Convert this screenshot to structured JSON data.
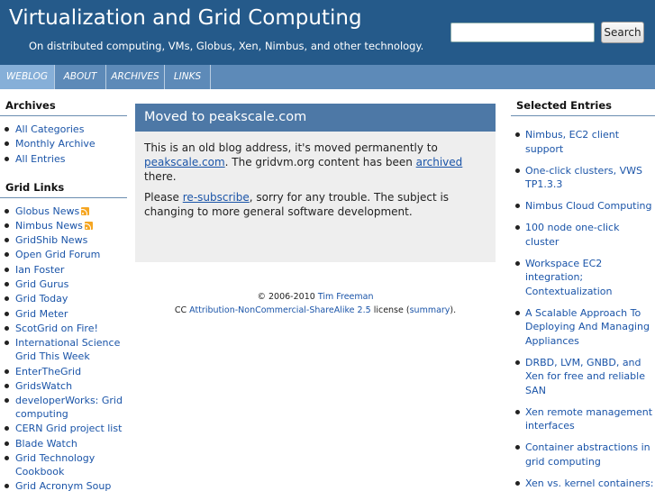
{
  "header": {
    "title": "Virtualization and Grid Computing",
    "tagline": "On distributed computing, VMs, Globus, Xen, Nimbus, and other technology.",
    "search_value": "",
    "search_button": "Search"
  },
  "nav": {
    "tabs": [
      {
        "label": "WEBLOG",
        "active": true
      },
      {
        "label": "ABOUT",
        "active": false
      },
      {
        "label": "ARCHIVES",
        "active": false
      },
      {
        "label": "LINKS",
        "active": false
      }
    ]
  },
  "left": {
    "archives_heading": "Archives",
    "archives": [
      "All Categories",
      "Monthly Archive",
      "All Entries"
    ],
    "links_heading": "Grid Links",
    "links": [
      {
        "label": "Globus News",
        "rss": true
      },
      {
        "label": "Nimbus News",
        "rss": true
      },
      {
        "label": "GridShib News",
        "rss": false
      },
      {
        "label": "Open Grid Forum",
        "rss": false
      },
      {
        "label": "Ian Foster",
        "rss": false
      },
      {
        "label": "Grid Gurus",
        "rss": false
      },
      {
        "label": "Grid Today",
        "rss": false
      },
      {
        "label": "Grid Meter",
        "rss": false
      },
      {
        "label": "ScotGrid on Fire!",
        "rss": false
      },
      {
        "label": "International Science Grid This Week",
        "rss": false
      },
      {
        "label": "EnterTheGrid",
        "rss": false
      },
      {
        "label": "GridsWatch",
        "rss": false
      },
      {
        "label": "developerWorks: Grid computing",
        "rss": false
      },
      {
        "label": "CERN Grid project list",
        "rss": false
      },
      {
        "label": "Blade Watch",
        "rss": false
      },
      {
        "label": "Grid Technology Cookbook",
        "rss": false
      },
      {
        "label": "Grid Acronym Soup",
        "rss": false
      }
    ]
  },
  "post": {
    "title": "Moved to peakscale.com",
    "p1_a": "This is an old blog address, it's moved permanently to ",
    "p1_link1": "peakscale.com",
    "p1_b": ". The gridvm.org content has been ",
    "p1_link2": "archived",
    "p1_c": " there.",
    "p2_a": "Please ",
    "p2_link": "re-subscribe",
    "p2_b": ", sorry for any trouble. The subject is changing to more general software development."
  },
  "footer": {
    "copy_a": "© 2006-2010 ",
    "author": "Tim Freeman",
    "cc_a": "CC ",
    "license": "Attribution-NonCommercial-ShareAlike 2.5",
    "cc_b": " license (",
    "summary": "summary",
    "cc_c": ")."
  },
  "right": {
    "heading": "Selected Entries",
    "entries": [
      "Nimbus, EC2 client support",
      "One-click clusters, VWS TP1.3.3",
      "Nimbus Cloud Computing",
      "100 node one-click cluster",
      "Workspace EC2 integration; Contextualization",
      "A Scalable Approach To Deploying And Managing Appliances",
      "DRBD, LVM, GNBD, and Xen for free and reliable SAN",
      "Xen remote management interfaces",
      "Container abstractions in grid computing",
      "Xen vs. kernel containers: performance and"
    ]
  },
  "colors": {
    "header_bg": "#255a8a",
    "nav_bg": "#5d8ab8",
    "nav_active": "#86afd8",
    "post_title_bg": "#4d78a6",
    "post_body_bg": "#eeeeee",
    "link": "#1a54a8",
    "rss_orange": "#f5a623"
  }
}
